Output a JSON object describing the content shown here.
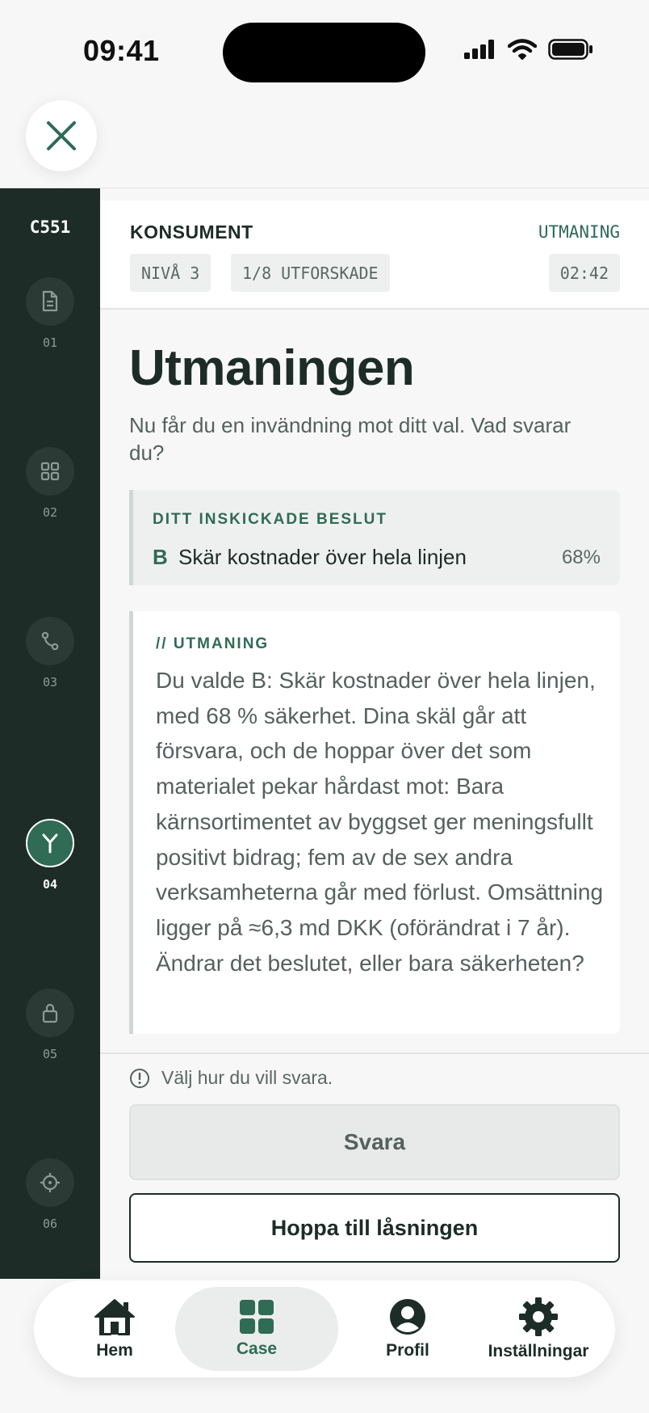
{
  "status_bar": {
    "time": "09:41"
  },
  "sidebar": {
    "case_code": "C551",
    "steps": [
      {
        "num": "01",
        "icon": "document-icon",
        "state": "done"
      },
      {
        "num": "02",
        "icon": "grid-icon",
        "state": "done"
      },
      {
        "num": "03",
        "icon": "route-icon",
        "state": "done"
      },
      {
        "num": "04",
        "icon": "fork-icon",
        "state": "active"
      },
      {
        "num": "05",
        "icon": "lock-icon",
        "state": "locked"
      },
      {
        "num": "06",
        "icon": "target-icon",
        "state": "locked"
      }
    ]
  },
  "header": {
    "category": "KONSUMENT",
    "phase": "UTMANING",
    "level": "NIVÅ 3",
    "explored": "1/8 UTFORSKADE",
    "timer": "02:42"
  },
  "main": {
    "title": "Utmaningen",
    "subtitle": "Nu får du en invändning mot ditt val. Vad svarar du?",
    "decision": {
      "label": "DITT INSKICKADE BESLUT",
      "letter": "B",
      "text": "Skär kostnader över hela linjen",
      "confidence": "68%"
    },
    "challenge": {
      "label": "// UTMANING",
      "text": "Du valde B: Skär kostnader över hela linjen, med 68 % säkerhet. Dina skäl går att försvara, och de hoppar över det som materialet pekar hårdast mot: Bara kärnsortimentet av byggset ger meningsfullt positivt bidrag; fem av de sex andra verksamheterna går med förlust. Omsättning ligger på ≈6,3 md DKK (oförändrat i 7 år). Ändrar det beslutet, eller bara säkerheten?"
    },
    "hint": "Välj hur du vill svara.",
    "respond_button": "Svara",
    "skip_button": "Hoppa till låsningen"
  },
  "bottom_nav": {
    "items": [
      {
        "label": "Hem",
        "icon": "home-icon"
      },
      {
        "label": "Case",
        "icon": "grid-icon"
      },
      {
        "label": "Profil",
        "icon": "profile-icon"
      },
      {
        "label": "Inställningar",
        "icon": "gear-icon"
      }
    ],
    "active": "Case"
  },
  "colors": {
    "accent": "#2f6b55",
    "sidebar_bg": "#1d2c27",
    "text_primary": "#1d2c27",
    "text_muted": "#55615c"
  }
}
